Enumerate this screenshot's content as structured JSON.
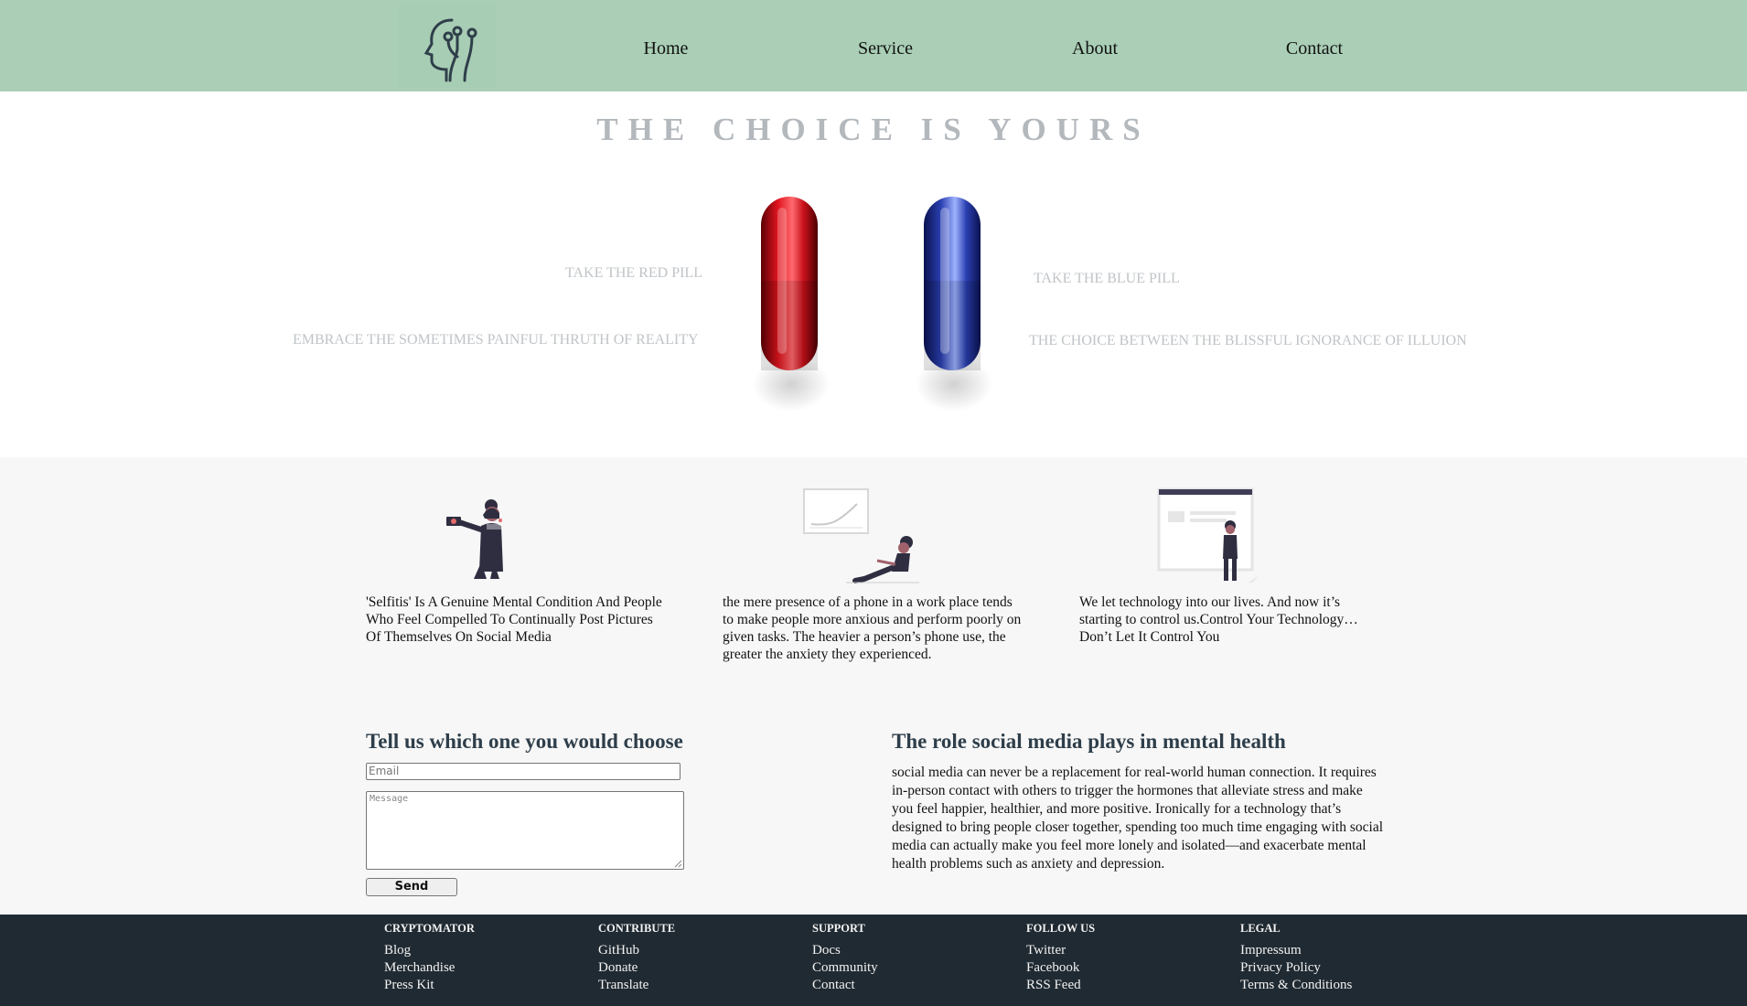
{
  "nav": {
    "logo_icon": "head-circuit-icon",
    "links": [
      "Home",
      "Service",
      "About",
      "Contact"
    ]
  },
  "hero": {
    "title": "THE CHOICE IS YOURS",
    "red_heading": "TAKE THE RED PILL",
    "red_text": "EMBRACE THE SOMETIMES PAINFUL THRUTH OF REALITY",
    "blue_heading": "TAKE THE BLUE PILL",
    "blue_text": "THE CHOICE BETWEEN THE BLISSFUL IGNORANCE OF ILLUION"
  },
  "cards": [
    {
      "icon": "selfie-person-illustration",
      "text": "'Selfitis' Is A Genuine Mental Condition And People Who Feel Compelled To Continually Post Pictures Of Themselves On Social Media"
    },
    {
      "icon": "person-phone-chart-illustration",
      "text": "the mere presence of a phone in a work place tends to make people more anxious and perform poorly on given tasks. The heavier a person’s phone use, the greater the anxiety they experienced."
    },
    {
      "icon": "person-screen-illustration",
      "text": "We let technology into our lives. And now it’s starting to control us.Control Your Technology… Don’t Let It Control You"
    }
  ],
  "form": {
    "title": "Tell us which one you would choose",
    "email_placeholder": "Email",
    "message_placeholder": "Message",
    "send_label": "Send"
  },
  "article": {
    "title": "The role social media plays in mental health",
    "body": "social media can never be a replacement for real-world human connection. It requires in-person contact with others to trigger the hormones that alleviate stress and make you feel happier, healthier, and more positive. Ironically for a technology that’s designed to bring people closer together, spending too much time engaging with social media can actually make you feel more lonely and isolated—and exacerbate mental health problems such as anxiety and depression."
  },
  "footer": {
    "columns": [
      {
        "heading": "CRYPTOMATOR",
        "links": [
          "Blog",
          "Merchandise",
          "Press Kit"
        ]
      },
      {
        "heading": "CONTRIBUTE",
        "links": [
          "GitHub",
          "Donate",
          "Translate"
        ]
      },
      {
        "heading": "SUPPORT",
        "links": [
          "Docs",
          "Community",
          "Contact"
        ]
      },
      {
        "heading": "FOLLOW US",
        "links": [
          "Twitter",
          "Facebook",
          "RSS Feed"
        ]
      },
      {
        "heading": "LEGAL",
        "links": [
          "Impressum",
          "Privacy Policy",
          "Terms & Conditions"
        ]
      }
    ]
  },
  "colors": {
    "nav_bg": "#aacfb6",
    "footer_bg": "#202a32",
    "red_pill": "#c8101a",
    "blue_pill": "#2a3fb0",
    "heading_color": "#2e3e4a"
  }
}
